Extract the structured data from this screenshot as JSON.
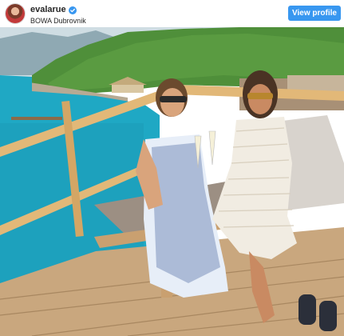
{
  "post": {
    "username": "evalarue",
    "location": "BOWA Dubrovnik",
    "view_profile_label": "View profile"
  },
  "colors": {
    "button": "#3897f0",
    "verified": "#3897f0",
    "text": "#262626",
    "sea": "#1fa8c4",
    "hill": "#4f8f3a",
    "deck": "#c9a77e"
  },
  "icons": {
    "verified": "verified-badge-icon",
    "avatar": "profile-picture"
  }
}
